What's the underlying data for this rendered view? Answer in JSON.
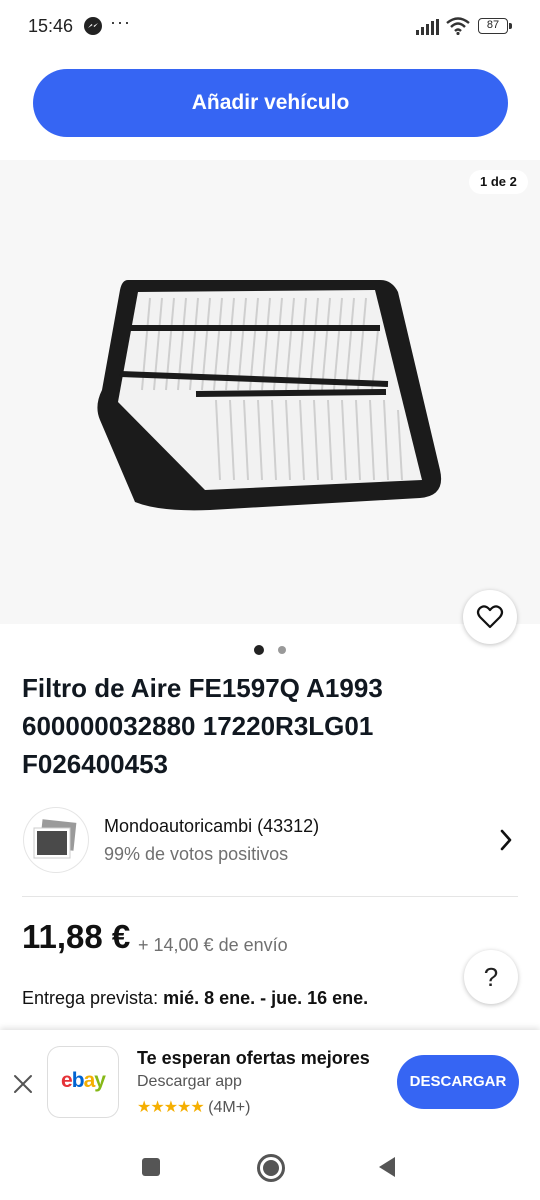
{
  "status_bar": {
    "time": "15:46",
    "more": "···",
    "battery": "87",
    "icons": [
      "messenger-icon",
      "signal-icon",
      "wifi-icon",
      "battery-icon"
    ]
  },
  "header": {
    "add_vehicle_label": "Añadir vehículo"
  },
  "gallery": {
    "counter": "1 de 2",
    "image": "air-filter-product-photo",
    "page_count": 2,
    "active_page": 1
  },
  "product": {
    "title": "Filtro de Aire FE1597Q A1993 600000032880 17220R3LG01 F026400453"
  },
  "seller": {
    "name": "Mondoautoricambi (43312)",
    "feedback": "99% de votos positivos"
  },
  "pricing": {
    "price": "11,88 €",
    "shipping": "+ 14,00 € de envío",
    "delivery_label": "Entrega prevista: ",
    "delivery_dates": "mié. 8 ene. - jue. 16 ene."
  },
  "help": {
    "label": "?"
  },
  "app_banner": {
    "logo_letters": [
      "e",
      "b",
      "a",
      "y"
    ],
    "title": "Te esperan ofertas mejores",
    "subtitle": "Descargar app",
    "stars": "★★★★★",
    "rating_count": "(4M+)",
    "download_label": "DESCARGAR"
  },
  "colors": {
    "brand_blue": "#3665f3",
    "star_gold": "#f5af02",
    "ebay_red": "#e53238",
    "ebay_blue": "#0064d2",
    "ebay_yellow": "#f5af02",
    "ebay_green": "#86b817"
  }
}
